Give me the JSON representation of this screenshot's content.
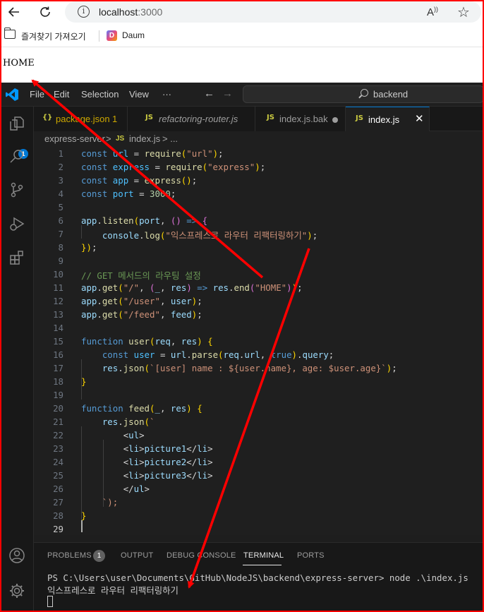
{
  "browser": {
    "url_host": "localhost",
    "url_port": ":3000",
    "favorites_label": "즐겨찾기 가져오기",
    "favorite_daum": "Daum"
  },
  "page": {
    "body_text": "HOME"
  },
  "vscode": {
    "menu": [
      "File",
      "Edit",
      "Selection",
      "View",
      "···"
    ],
    "search_label": "backend",
    "tabs": [
      {
        "icon": "{}",
        "label": "package.json",
        "meta": "1",
        "active": false
      },
      {
        "icon": "JS",
        "label": "refactoring-router.js",
        "active": false
      },
      {
        "icon": "JS",
        "label": "index.js.bak",
        "active": false,
        "modified": true
      },
      {
        "icon": "JS",
        "label": "index.js",
        "active": true
      }
    ],
    "breadcrumb": {
      "folder": "express-server",
      "sep": ">",
      "file_icon": "JS",
      "file": "index.js",
      "tail": "> ..."
    },
    "problems_badge": "1",
    "explorer_badge": "1",
    "code_lines": [
      "const url = require(\"url\");",
      "const express = require(\"express\");",
      "const app = express();",
      "const port = 3000;",
      "",
      "app.listen(port, () => {",
      "    console.log(\"익스프레스로 라우터 리팩터링하기\");",
      "});",
      "",
      "// GET 메서드의 라우팅 설정",
      "app.get(\"/\", (_, res) => res.end(\"HOME\"));",
      "app.get(\"/user\", user);",
      "app.get(\"/feed\", feed);",
      "",
      "function user(req, res) {",
      "    const user = url.parse(req.url, true).query;",
      "    res.json(`[user] name : ${user.name}, age: $user.age}`);",
      "}",
      "",
      "function feed(_, res) {",
      "    res.json(`",
      "        <ul>",
      "        <li>picture1</li>",
      "        <li>picture2</li>",
      "        <li>picture3</li>",
      "        </ul>",
      "    `);",
      "}",
      ""
    ],
    "panel_tabs": [
      "PROBLEMS",
      "OUTPUT",
      "DEBUG CONSOLE",
      "TERMINAL",
      "PORTS"
    ],
    "terminal": {
      "prompt": "PS C:\\Users\\user\\Documents\\GitHub\\NodeJS\\backend\\express-server> node .\\index.js",
      "output": "익스프레스로 라우터 리팩터링하기"
    }
  },
  "colors": {
    "arrow": "#ff0000",
    "accent": "#0078d4",
    "editor_bg": "#1f1f1f"
  }
}
